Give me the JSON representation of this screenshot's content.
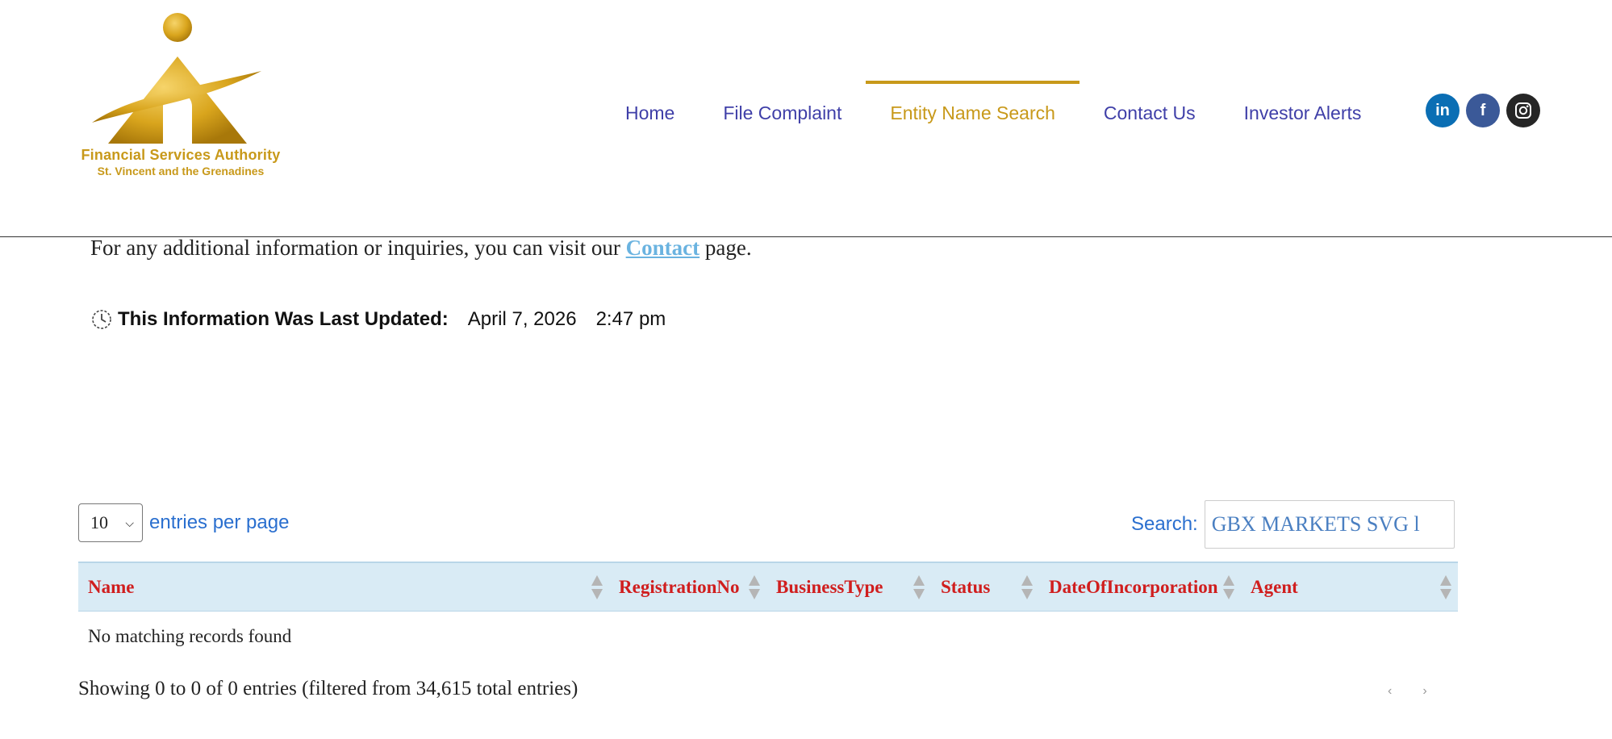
{
  "brand": {
    "name": "Financial Services Authority",
    "subtitle": "St. Vincent and the Grenadines",
    "color": "#c8991a"
  },
  "nav": {
    "items": [
      {
        "label": "Home"
      },
      {
        "label": "File Complaint"
      },
      {
        "label": "Entity Name Search",
        "active": true
      },
      {
        "label": "Contact Us"
      },
      {
        "label": "Investor Alerts"
      }
    ],
    "link_color": "#3f3fa8",
    "active_color": "#c8991a"
  },
  "social": {
    "linkedin_label": "in",
    "facebook_label": "f",
    "icons": [
      "linkedin-icon",
      "facebook-icon",
      "instagram-icon"
    ]
  },
  "info": {
    "prefix": "For any additional information or inquiries, you can visit our",
    "link_text": "Contact",
    "suffix": "page."
  },
  "updated": {
    "label": "This Information Was Last Updated:",
    "date": "April 7, 2026",
    "time": "2:47 pm"
  },
  "table_controls": {
    "entries_value": "10",
    "entries_label": "entries per page",
    "search_label": "Search:",
    "search_value": "GBX MARKETS SVG l"
  },
  "table": {
    "columns": [
      "Name",
      "RegistrationNo",
      "BusinessType",
      "Status",
      "DateOfIncorporation",
      "Agent"
    ],
    "empty_message": "No matching records found",
    "header_bg": "#d9ebf5",
    "header_color": "#d01e1e"
  },
  "footer": {
    "info": "Showing 0 to 0 of 0 entries (filtered from 34,615 total entries)",
    "prev": "‹",
    "next": "›"
  }
}
